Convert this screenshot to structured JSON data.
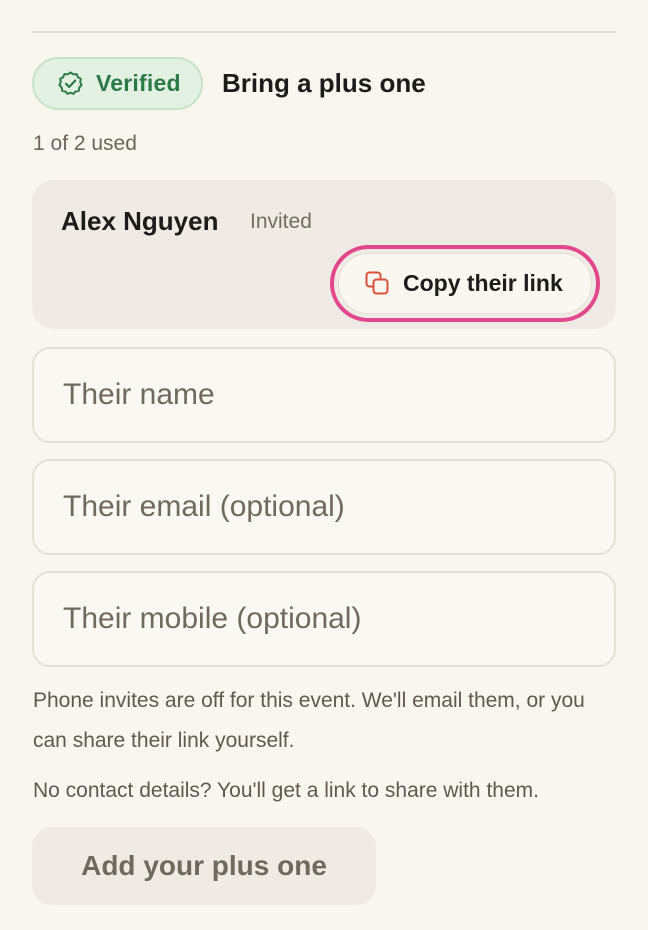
{
  "header": {
    "badge_label": "Verified",
    "badge_icon": "check-circle-icon",
    "title": "Bring a plus one"
  },
  "usage": {
    "text": "1 of 2 used",
    "used": 1,
    "total": 2
  },
  "guest": {
    "name": "Alex Nguyen",
    "status": "Invited",
    "copy_link_label": "Copy their link",
    "copy_icon": "copy-icon"
  },
  "form": {
    "name_placeholder": "Their name",
    "email_placeholder": "Their email (optional)",
    "mobile_placeholder": "Their mobile (optional)",
    "name_value": "",
    "email_value": "",
    "mobile_value": ""
  },
  "help": {
    "phone_note": "Phone invites are off for this event. We'll email them, or you can share their link yourself.",
    "no_contact_note": "No contact details? You'll get a link to share with them."
  },
  "actions": {
    "add_label": "Add your plus one"
  },
  "colors": {
    "background": "#f9f6ef",
    "verified_green": "#2c7a46",
    "verified_bg": "#e2f1e4",
    "copy_icon_red": "#d9513b",
    "highlight_pink": "#e2468c",
    "card_bg": "#efebe4"
  }
}
